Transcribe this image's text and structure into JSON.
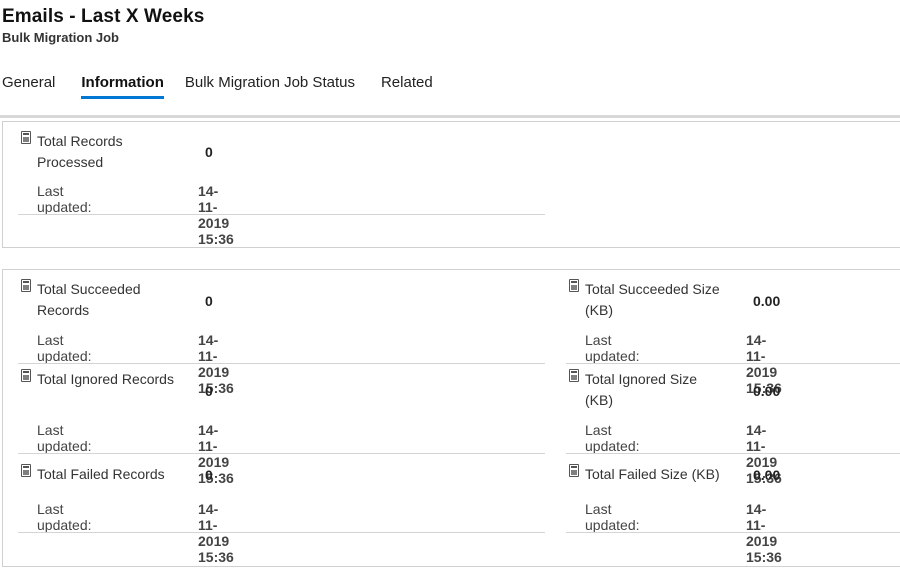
{
  "header": {
    "title": "Emails - Last X Weeks",
    "subtitle": "Bulk Migration Job"
  },
  "tabs": [
    {
      "label": "General",
      "active": false
    },
    {
      "label": "Information",
      "active": true
    },
    {
      "label": "Bulk Migration Job Status",
      "active": false
    },
    {
      "label": "Related",
      "active": false
    }
  ],
  "accent_color": "#0078d4",
  "rollup_icon": "calculator-icon",
  "last_updated_label": "Last updated:",
  "section1": {
    "total_records_processed": {
      "label": "Total Records Processed",
      "value": "0",
      "last_updated": "14-11-2019 15:36"
    }
  },
  "section2": {
    "total_succeeded_records": {
      "label": "Total Succeeded Records",
      "value": "0",
      "last_updated": "14-11-2019 15:36"
    },
    "total_ignored_records": {
      "label": "Total Ignored Records",
      "value": "0",
      "last_updated": "14-11-2019 15:36"
    },
    "total_failed_records": {
      "label": "Total Failed Records",
      "value": "0",
      "last_updated": "14-11-2019 15:36"
    },
    "total_succeeded_size": {
      "label": "Total Succeeded Size (KB)",
      "value": "0.00",
      "last_updated": "14-11-2019 15:36"
    },
    "total_ignored_size": {
      "label": "Total Ignored Size (KB)",
      "value": "0.00",
      "last_updated": "14-11-2019 15:36"
    },
    "total_failed_size": {
      "label": "Total Failed Size (KB)",
      "value": "0.00",
      "last_updated": "14-11-2019 15:36"
    }
  }
}
